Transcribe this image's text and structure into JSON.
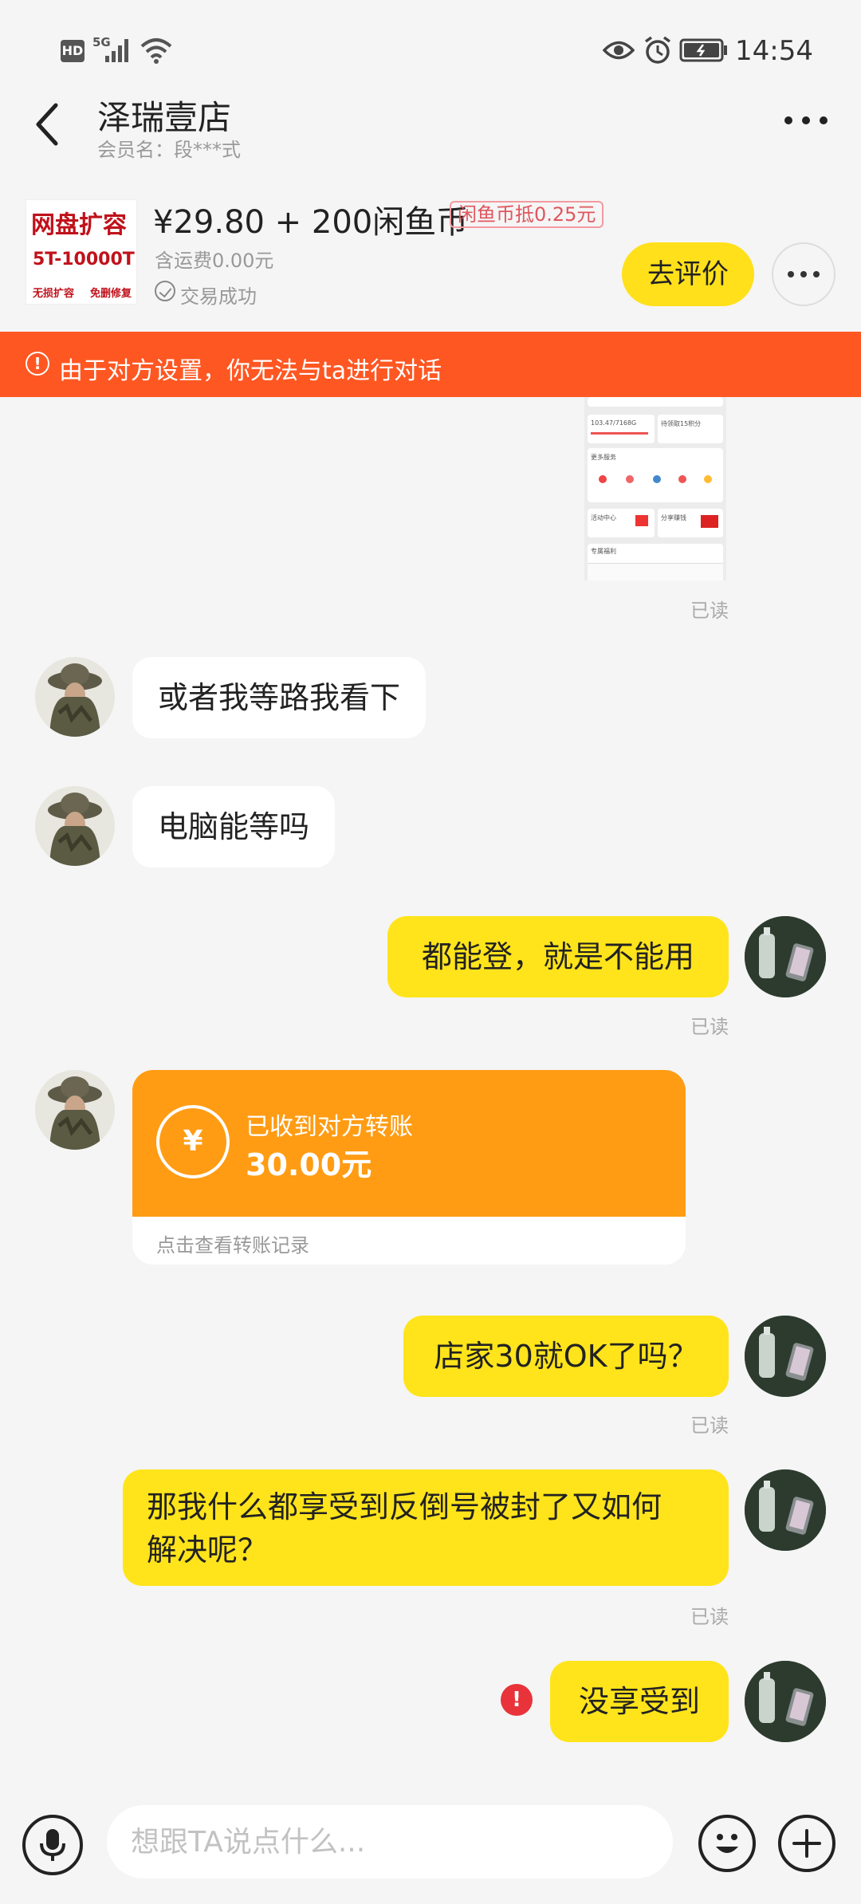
{
  "status_bar": {
    "hd": "HD",
    "network": "5G",
    "time": "14:54"
  },
  "header": {
    "title": "泽瑞壹店",
    "member": "会员名：段***式"
  },
  "product": {
    "image_line1": "网盘扩容",
    "image_line2": "5T-10000T",
    "image_line3a": "无损扩容",
    "image_line3b": "免删修复",
    "price": "¥29.80 + 200闲鱼币",
    "coin_tag": "闲鱼币抵0.25元",
    "shipping": "含运费0.00元",
    "deal_status": "交易成功",
    "review_button": "去评价"
  },
  "warning": {
    "text": "由于对方设置，你无法与ta进行对话"
  },
  "screenshot_preview": {
    "text1": "103.47/7168G",
    "text2": "待领取15积分",
    "text3": "更多服务",
    "text4": "活动中心",
    "text5": "分享赚钱",
    "text6": "专属福利"
  },
  "messages": [
    {
      "from": "seller",
      "text": "或者我等路我看下"
    },
    {
      "from": "seller",
      "text": "电脑能等吗"
    },
    {
      "from": "me",
      "text": "都能登，就是不能用"
    },
    {
      "from": "me",
      "text": "店家30就OK了吗？"
    },
    {
      "from": "me",
      "text_line1": "那我什么都享受到反倒号被封了又如何",
      "text_line2": "解决呢？"
    },
    {
      "from": "me",
      "text": "没享受到"
    }
  ],
  "read_label": "已读",
  "transfer": {
    "line1": "已收到对方转账",
    "amount": "30.00元",
    "footer": "点击查看转账记录"
  },
  "input": {
    "placeholder": "想跟TA说点什么..."
  },
  "colors": {
    "accent_yellow": "#ffe41b",
    "warning_orange": "#ff5722",
    "transfer_orange": "#ff9c14",
    "error_red": "#e8333b"
  }
}
